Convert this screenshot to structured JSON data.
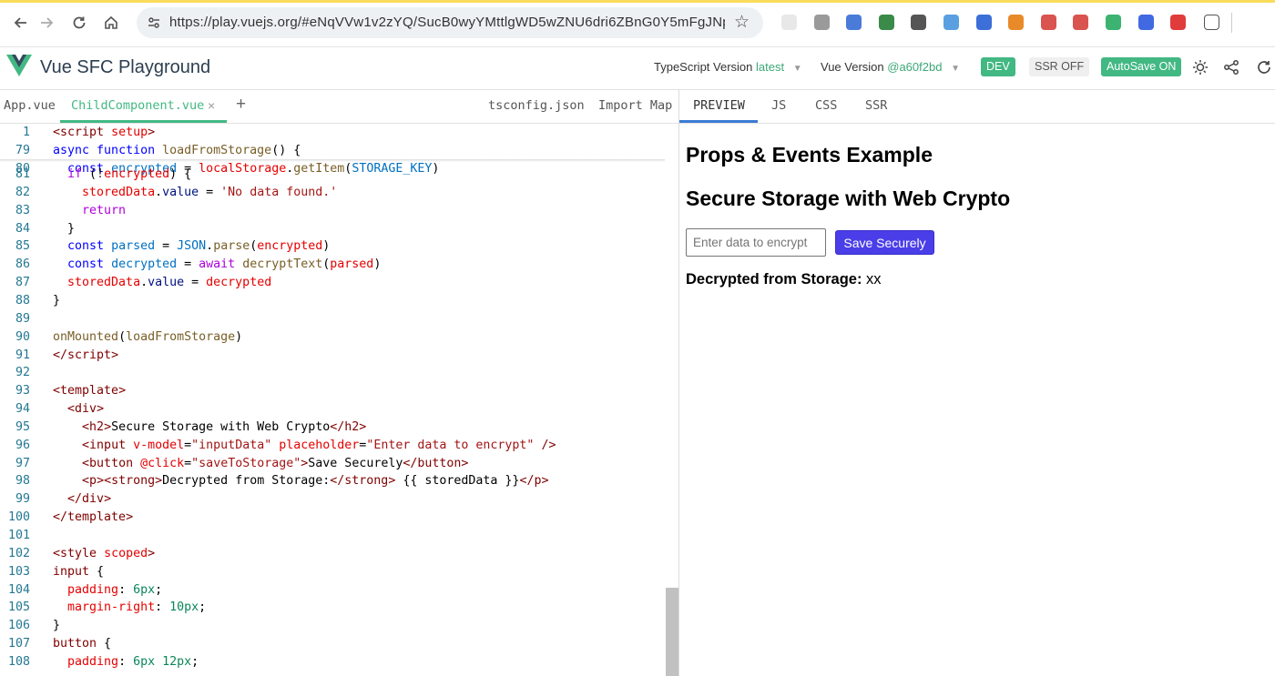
{
  "browser": {
    "url": "https://play.vuejs.org/#eNqVVw1v2zYQ/SucB0wyYMttlgWD5wZNU6dri6ZBnG0Y5mFgJNpil...",
    "extension_colors": [
      "#e8e8e8",
      "#9a9a9a",
      "#4a7bd8",
      "#3a8a4a",
      "#555555",
      "#5aa0e0",
      "#3c6fd8",
      "#e88a2a",
      "#d9534f",
      "#d9534f",
      "#3cb371",
      "#4169e1",
      "#e03c3c"
    ]
  },
  "header": {
    "title": "Vue SFC Playground",
    "ts_label": "TypeScript Version",
    "ts_value": "latest",
    "vue_label": "Vue Version",
    "vue_value": "@a60f2bd",
    "dev": "DEV",
    "ssr": "SSR OFF",
    "autosave": "AutoSave ON"
  },
  "editor_tabs": {
    "app": "App.vue",
    "child": "ChildComponent.vue",
    "close": "×",
    "add": "+",
    "tsconfig": "tsconfig.json",
    "import_map": "Import Map"
  },
  "preview_tabs": {
    "preview": "PREVIEW",
    "js": "JS",
    "css": "CSS",
    "ssr": "SSR"
  },
  "code_lines": [
    {
      "n": "1",
      "tokens": [
        [
          "t-angle",
          "<"
        ],
        [
          "t-tag",
          "script"
        ],
        [
          "t-txt",
          " "
        ],
        [
          "t-attr",
          "setup"
        ],
        [
          "t-angle",
          ">"
        ]
      ]
    },
    {
      "n": "79",
      "tokens": [
        [
          "t-kw",
          "async"
        ],
        [
          "t-txt",
          " "
        ],
        [
          "t-kw",
          "function"
        ],
        [
          "t-txt",
          " "
        ],
        [
          "t-fn",
          "loadFromStorage"
        ],
        [
          "t-txt",
          "() {"
        ]
      ]
    },
    {
      "n": "80",
      "tokens": [
        [
          "t-txt",
          "  "
        ],
        [
          "t-kw",
          "const"
        ],
        [
          "t-txt",
          " "
        ],
        [
          "t-const",
          "encrypted"
        ],
        [
          "t-txt",
          " = "
        ],
        [
          "t-dvar",
          "localStorage"
        ],
        [
          "t-txt",
          "."
        ],
        [
          "t-fn",
          "getItem"
        ],
        [
          "t-txt",
          "("
        ],
        [
          "t-const",
          "STORAGE_KEY"
        ],
        [
          "t-txt",
          ")"
        ]
      ]
    },
    {
      "n": "81",
      "tokens": [
        [
          "t-txt",
          "  "
        ],
        [
          "t-ctrl",
          "if"
        ],
        [
          "t-txt",
          " (!"
        ],
        [
          "t-dvar",
          "encrypted"
        ],
        [
          "t-txt",
          ") {"
        ]
      ]
    },
    {
      "n": "82",
      "tokens": [
        [
          "t-txt",
          "    "
        ],
        [
          "t-dvar",
          "storedData"
        ],
        [
          "t-txt",
          "."
        ],
        [
          "t-var",
          "value"
        ],
        [
          "t-txt",
          " = "
        ],
        [
          "t-str",
          "'No data found.'"
        ]
      ]
    },
    {
      "n": "83",
      "tokens": [
        [
          "t-txt",
          "    "
        ],
        [
          "t-ctrl",
          "return"
        ]
      ]
    },
    {
      "n": "84",
      "tokens": [
        [
          "t-txt",
          "  }"
        ]
      ]
    },
    {
      "n": "85",
      "tokens": [
        [
          "t-txt",
          "  "
        ],
        [
          "t-kw",
          "const"
        ],
        [
          "t-txt",
          " "
        ],
        [
          "t-const",
          "parsed"
        ],
        [
          "t-txt",
          " = "
        ],
        [
          "t-const",
          "JSON"
        ],
        [
          "t-txt",
          "."
        ],
        [
          "t-fn",
          "parse"
        ],
        [
          "t-txt",
          "("
        ],
        [
          "t-dvar",
          "encrypted"
        ],
        [
          "t-txt",
          ")"
        ]
      ]
    },
    {
      "n": "86",
      "tokens": [
        [
          "t-txt",
          "  "
        ],
        [
          "t-kw",
          "const"
        ],
        [
          "t-txt",
          " "
        ],
        [
          "t-const",
          "decrypted"
        ],
        [
          "t-txt",
          " = "
        ],
        [
          "t-ctrl",
          "await"
        ],
        [
          "t-txt",
          " "
        ],
        [
          "t-fn",
          "decryptText"
        ],
        [
          "t-txt",
          "("
        ],
        [
          "t-dvar",
          "parsed"
        ],
        [
          "t-txt",
          ")"
        ]
      ]
    },
    {
      "n": "87",
      "tokens": [
        [
          "t-txt",
          "  "
        ],
        [
          "t-dvar",
          "storedData"
        ],
        [
          "t-txt",
          "."
        ],
        [
          "t-var",
          "value"
        ],
        [
          "t-txt",
          " = "
        ],
        [
          "t-dvar",
          "decrypted"
        ]
      ]
    },
    {
      "n": "88",
      "tokens": [
        [
          "t-txt",
          "}"
        ]
      ]
    },
    {
      "n": "89",
      "tokens": []
    },
    {
      "n": "90",
      "tokens": [
        [
          "t-fn",
          "onMounted"
        ],
        [
          "t-txt",
          "("
        ],
        [
          "t-fn",
          "loadFromStorage"
        ],
        [
          "t-txt",
          ")"
        ]
      ]
    },
    {
      "n": "91",
      "tokens": [
        [
          "t-angle",
          "</"
        ],
        [
          "t-tag",
          "script"
        ],
        [
          "t-angle",
          ">"
        ]
      ]
    },
    {
      "n": "92",
      "tokens": []
    },
    {
      "n": "93",
      "tokens": [
        [
          "t-angle",
          "<"
        ],
        [
          "t-tag",
          "template"
        ],
        [
          "t-angle",
          ">"
        ]
      ]
    },
    {
      "n": "94",
      "tokens": [
        [
          "t-txt",
          "  "
        ],
        [
          "t-angle",
          "<"
        ],
        [
          "t-tag",
          "div"
        ],
        [
          "t-angle",
          ">"
        ]
      ]
    },
    {
      "n": "95",
      "tokens": [
        [
          "t-txt",
          "    "
        ],
        [
          "t-angle",
          "<"
        ],
        [
          "t-tag",
          "h2"
        ],
        [
          "t-angle",
          ">"
        ],
        [
          "t-txt",
          "Secure Storage with Web Crypto"
        ],
        [
          "t-angle",
          "</"
        ],
        [
          "t-tag",
          "h2"
        ],
        [
          "t-angle",
          ">"
        ]
      ]
    },
    {
      "n": "96",
      "tokens": [
        [
          "t-txt",
          "    "
        ],
        [
          "t-angle",
          "<"
        ],
        [
          "t-tag",
          "input"
        ],
        [
          "t-txt",
          " "
        ],
        [
          "t-attr",
          "v-model"
        ],
        [
          "t-txt",
          "="
        ],
        [
          "t-str",
          "\"inputData\""
        ],
        [
          "t-txt",
          " "
        ],
        [
          "t-attr",
          "placeholder"
        ],
        [
          "t-txt",
          "="
        ],
        [
          "t-str",
          "\"Enter data to encrypt\""
        ],
        [
          "t-txt",
          " "
        ],
        [
          "t-angle",
          "/>"
        ]
      ]
    },
    {
      "n": "97",
      "tokens": [
        [
          "t-txt",
          "    "
        ],
        [
          "t-angle",
          "<"
        ],
        [
          "t-tag",
          "button"
        ],
        [
          "t-txt",
          " "
        ],
        [
          "t-attr",
          "@click"
        ],
        [
          "t-txt",
          "="
        ],
        [
          "t-str",
          "\"saveToStorage\""
        ],
        [
          "t-angle",
          ">"
        ],
        [
          "t-txt",
          "Save Securely"
        ],
        [
          "t-angle",
          "</"
        ],
        [
          "t-tag",
          "button"
        ],
        [
          "t-angle",
          ">"
        ]
      ]
    },
    {
      "n": "98",
      "tokens": [
        [
          "t-txt",
          "    "
        ],
        [
          "t-angle",
          "<"
        ],
        [
          "t-tag",
          "p"
        ],
        [
          "t-angle",
          "><"
        ],
        [
          "t-tag",
          "strong"
        ],
        [
          "t-angle",
          ">"
        ],
        [
          "t-txt",
          "Decrypted from Storage:"
        ],
        [
          "t-angle",
          "</"
        ],
        [
          "t-tag",
          "strong"
        ],
        [
          "t-angle",
          ">"
        ],
        [
          "t-txt",
          " {{ storedData }}"
        ],
        [
          "t-angle",
          "</"
        ],
        [
          "t-tag",
          "p"
        ],
        [
          "t-angle",
          ">"
        ]
      ]
    },
    {
      "n": "99",
      "tokens": [
        [
          "t-txt",
          "  "
        ],
        [
          "t-angle",
          "</"
        ],
        [
          "t-tag",
          "div"
        ],
        [
          "t-angle",
          ">"
        ]
      ]
    },
    {
      "n": "100",
      "tokens": [
        [
          "t-angle",
          "</"
        ],
        [
          "t-tag",
          "template"
        ],
        [
          "t-angle",
          ">"
        ]
      ]
    },
    {
      "n": "101",
      "tokens": []
    },
    {
      "n": "102",
      "tokens": [
        [
          "t-angle",
          "<"
        ],
        [
          "t-tag",
          "style"
        ],
        [
          "t-txt",
          " "
        ],
        [
          "t-attr",
          "scoped"
        ],
        [
          "t-angle",
          ">"
        ]
      ]
    },
    {
      "n": "103",
      "tokens": [
        [
          "t-sel",
          "input"
        ],
        [
          "t-txt",
          " {"
        ]
      ]
    },
    {
      "n": "104",
      "tokens": [
        [
          "t-txt",
          "  "
        ],
        [
          "t-prop",
          "padding"
        ],
        [
          "t-txt",
          ": "
        ],
        [
          "t-num",
          "6px"
        ],
        [
          "t-txt",
          ";"
        ]
      ]
    },
    {
      "n": "105",
      "tokens": [
        [
          "t-txt",
          "  "
        ],
        [
          "t-prop",
          "margin-right"
        ],
        [
          "t-txt",
          ": "
        ],
        [
          "t-num",
          "10px"
        ],
        [
          "t-txt",
          ";"
        ]
      ]
    },
    {
      "n": "106",
      "tokens": [
        [
          "t-txt",
          "}"
        ]
      ]
    },
    {
      "n": "107",
      "tokens": [
        [
          "t-sel",
          "button"
        ],
        [
          "t-txt",
          " {"
        ]
      ]
    },
    {
      "n": "108",
      "tokens": [
        [
          "t-txt",
          "  "
        ],
        [
          "t-prop",
          "padding"
        ],
        [
          "t-txt",
          ": "
        ],
        [
          "t-num",
          "6px 12px"
        ],
        [
          "t-txt",
          ";"
        ]
      ]
    }
  ],
  "preview": {
    "heading1": "Props & Events Example",
    "heading2": "Secure Storage with Web Crypto",
    "input_placeholder": "Enter data to encrypt",
    "button": "Save Securely",
    "result_label": "Decrypted from Storage:",
    "result_value": " xx"
  }
}
